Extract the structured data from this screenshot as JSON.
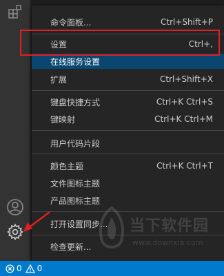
{
  "menu": {
    "items": [
      {
        "label": "命令面板...",
        "shortcut": "Ctrl+Shift+P"
      },
      {
        "label": "设置",
        "shortcut": "Ctrl+,"
      },
      {
        "label": "在线服务设置",
        "shortcut": ""
      },
      {
        "label": "扩展",
        "shortcut": "Ctrl+Shift+X"
      },
      {
        "label": "键盘快捷方式",
        "shortcut": "Ctrl+K Ctrl+S"
      },
      {
        "label": "键映射",
        "shortcut": "Ctrl+K Ctrl+M"
      },
      {
        "label": "用户代码片段",
        "shortcut": ""
      },
      {
        "label": "颜色主题",
        "shortcut": "Ctrl+K Ctrl+T"
      },
      {
        "label": "文件图标主题",
        "shortcut": ""
      },
      {
        "label": "产品图标主题",
        "shortcut": ""
      },
      {
        "label": "打开设置同步...",
        "shortcut": ""
      },
      {
        "label": "检查更新...",
        "shortcut": ""
      }
    ]
  },
  "activity_bar": {
    "icons": [
      "extensions-icon",
      "account-icon",
      "gear-icon"
    ]
  },
  "status_bar": {
    "errors": "0",
    "warnings": "0"
  },
  "watermark": {
    "title": "当下软件园",
    "url": "www.downxia.com"
  },
  "colors": {
    "menu_bg": "#252526",
    "hover_bg": "#094771",
    "status_bg": "#007acc",
    "annotation": "#e02020"
  }
}
